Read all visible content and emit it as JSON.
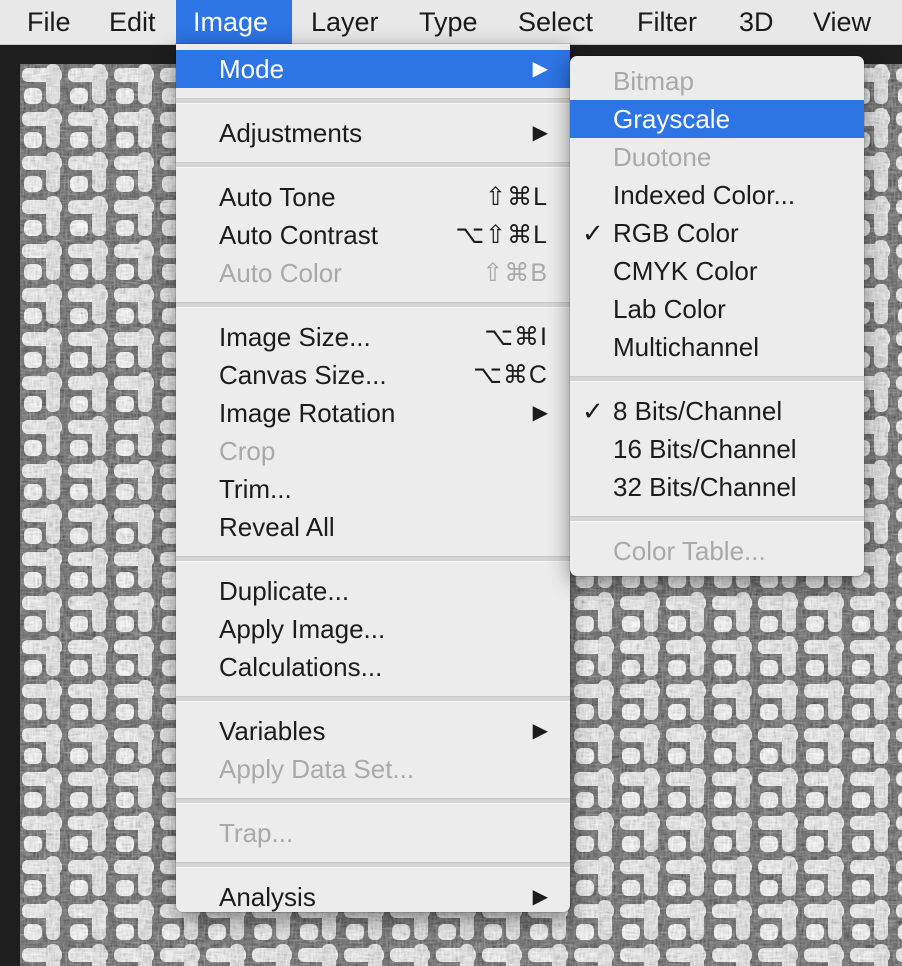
{
  "menubar": {
    "items": [
      {
        "label": "File"
      },
      {
        "label": "Edit"
      },
      {
        "label": "Image"
      },
      {
        "label": "Layer"
      },
      {
        "label": "Type"
      },
      {
        "label": "Select"
      },
      {
        "label": "Filter"
      },
      {
        "label": "3D"
      },
      {
        "label": "View"
      }
    ],
    "active": "Image"
  },
  "image_menu": {
    "mode": "Mode",
    "adjustments": "Adjustments",
    "auto_tone": {
      "label": "Auto Tone",
      "shortcut": "⇧⌘L"
    },
    "auto_contrast": {
      "label": "Auto Contrast",
      "shortcut": "⌥⇧⌘L"
    },
    "auto_color": {
      "label": "Auto Color",
      "shortcut": "⇧⌘B"
    },
    "image_size": {
      "label": "Image Size...",
      "shortcut": "⌥⌘I"
    },
    "canvas_size": {
      "label": "Canvas Size...",
      "shortcut": "⌥⌘C"
    },
    "image_rotation": "Image Rotation",
    "crop": "Crop",
    "trim": "Trim...",
    "reveal_all": "Reveal All",
    "duplicate": "Duplicate...",
    "apply_image": "Apply Image...",
    "calculations": "Calculations...",
    "variables": "Variables",
    "apply_data_set": "Apply Data Set...",
    "trap": "Trap...",
    "analysis": "Analysis",
    "submenu_arrow": "▶"
  },
  "mode_menu": {
    "bitmap": "Bitmap",
    "grayscale": "Grayscale",
    "duotone": "Duotone",
    "indexed_color": "Indexed Color...",
    "rgb_color": "RGB Color",
    "cmyk_color": "CMYK Color",
    "lab_color": "Lab Color",
    "multichannel": "Multichannel",
    "bits_8": "8 Bits/Channel",
    "bits_16": "16 Bits/Channel",
    "bits_32": "32 Bits/Channel",
    "color_table": "Color Table...",
    "checkmark": "✓"
  },
  "colors": {
    "highlight": "#2d74e5",
    "menu_bg": "#ececec",
    "disabled_text": "#a9a9a9"
  }
}
